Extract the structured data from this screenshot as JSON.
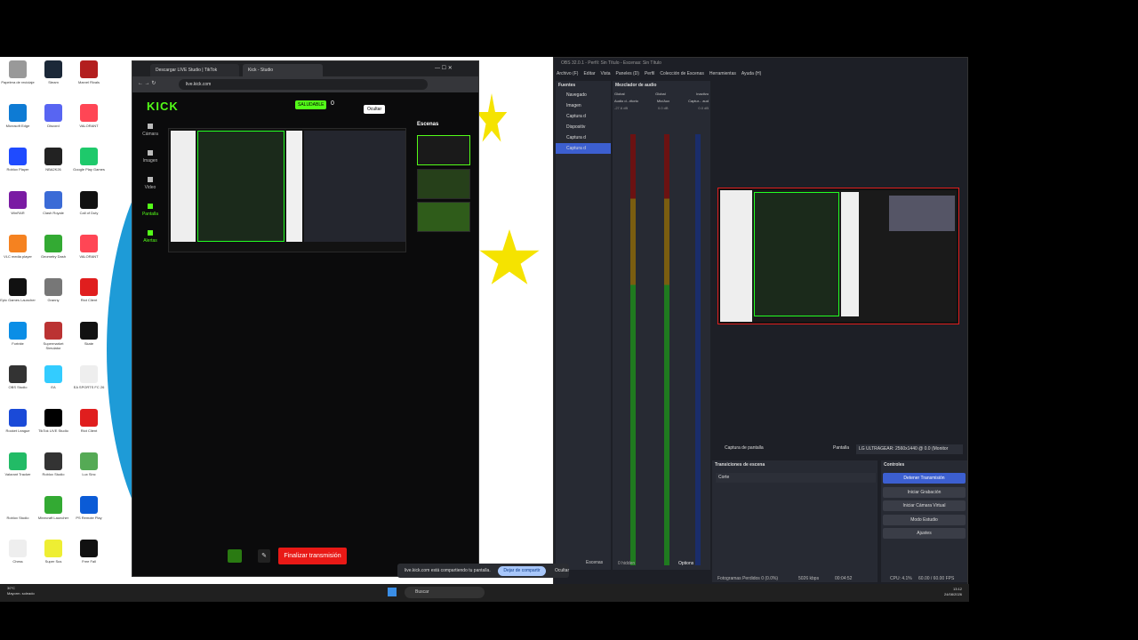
{
  "browser": {
    "tabs": [
      {
        "label": "Descargar LIVE Studio | TikTok"
      },
      {
        "label": "Kick - Studio"
      }
    ],
    "url": "live.kick.com",
    "logo": "KICK",
    "healthy_label": "SALUDABLE",
    "viewers": "0",
    "sidebar": [
      {
        "label": "Cámara"
      },
      {
        "label": "Imagen"
      },
      {
        "label": "Video"
      },
      {
        "label": "Pantalla"
      },
      {
        "label": "Alertas"
      }
    ],
    "scenes_title": "Escenas",
    "tooltip": "Ocultar",
    "end_button": "Finalizar transmisión"
  },
  "share_bar": {
    "text": "live.kick.com está compartiendo tu pantalla.",
    "stop": "Dejar de compartir",
    "hide": "Ocultar"
  },
  "obs": {
    "title": "OBS 32.0.1 - Perfil: Sin Título - Escenas: Sin Título",
    "menu": [
      "Archivo (F)",
      "Editar",
      "Vista",
      "Paneles (D)",
      "Perfil",
      "Colección de Escenas",
      "Herramientas",
      "Ayuda (H)"
    ],
    "sources_title": "Fuentes",
    "sources": [
      {
        "label": "Navegado"
      },
      {
        "label": "Imagen"
      },
      {
        "label": "Captura d"
      },
      {
        "label": "Dispositiv"
      },
      {
        "label": "Captura d"
      },
      {
        "label": "Captura d"
      }
    ],
    "mixer_title": "Mezclador de audio",
    "mixer_headers": [
      "Global",
      "Global",
      "Inactivo"
    ],
    "mixer_channels": [
      "Audio d...ritorio",
      "Mic/Aux",
      "Captur... aud"
    ],
    "mixer_db": [
      "-27.6 dB",
      "0.0 dB",
      "0.0 dB"
    ],
    "source_bar_name": "Captura de pantalla",
    "screen_label": "Pantalla",
    "monitor": "LG ULTRAGEAR: 2560x1440 @ 0.0 (Monitor",
    "transitions_title": "Transiciones de escena",
    "transition_value": "Corte",
    "controls_title": "Controles",
    "controls": [
      {
        "label": "Detener Transmisión"
      },
      {
        "label": "Iniciar Grabación"
      },
      {
        "label": "Iniciar Cámara Virtual"
      },
      {
        "label": "Modo Estudio"
      },
      {
        "label": "Ajustes"
      }
    ],
    "bottom_tabs": [
      "Escenas",
      "0 hidden",
      "Options"
    ],
    "status": {
      "frames": "Fotogramas Perdidos 0 (0.0%)",
      "kbps": "5026 kbps",
      "time": "00:04:52",
      "cpu": "CPU: 4.1%",
      "fps": "60.00 / 60.00 FPS"
    }
  },
  "taskbar": {
    "search_placeholder": "Buscar",
    "weather_temp": "30°C",
    "weather_desc": "Mayorm. soleado",
    "time": "13:12",
    "date": "24/08/2026"
  },
  "desktop_icons": [
    {
      "label": "Papelera de reciclaje"
    },
    {
      "label": "Steam"
    },
    {
      "label": "Marvel Rivals"
    },
    {
      "label": "Microsoft Edge"
    },
    {
      "label": "Discord"
    },
    {
      "label": "VALORANT"
    },
    {
      "label": "Roblox Player"
    },
    {
      "label": "NBA2K26"
    },
    {
      "label": "Google Play Games"
    },
    {
      "label": "WinRAR"
    },
    {
      "label": "Clash Royale"
    },
    {
      "label": "Call of Duty"
    },
    {
      "label": "VLC media player"
    },
    {
      "label": "Geometry Dash"
    },
    {
      "label": "VALORANT"
    },
    {
      "label": "Epic Games Launcher"
    },
    {
      "label": "Granny"
    },
    {
      "label": "Riot Client"
    },
    {
      "label": "Fortnite"
    },
    {
      "label": "Supermarket Simulator"
    },
    {
      "label": "Skate"
    },
    {
      "label": "OBS Studio"
    },
    {
      "label": "EA"
    },
    {
      "label": "EA SPORTS FC 26"
    },
    {
      "label": "Rocket League"
    },
    {
      "label": "TikTok LIVE Studio"
    },
    {
      "label": "Riot Client"
    },
    {
      "label": "Valorant Tracker"
    },
    {
      "label": "Roblox Studio"
    },
    {
      "label": "Lux Sinc"
    },
    {
      "label": "Roblox Studio"
    },
    {
      "label": "Minecraft Launcher"
    },
    {
      "label": "PS Remote Play"
    },
    {
      "label": "Chess"
    },
    {
      "label": "Super Sus"
    },
    {
      "label": "Free Fall"
    }
  ]
}
